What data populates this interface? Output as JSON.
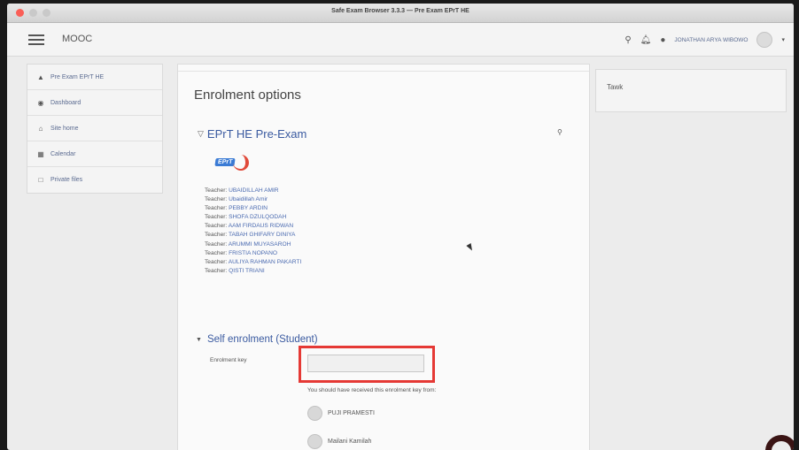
{
  "window": {
    "title": "Safe Exam Browser 3.3.3 — Pre Exam EPrT HE"
  },
  "navbar": {
    "brand": "MOOC",
    "user_name": "JONATHAN ARYA WIBOWO"
  },
  "sidebar": {
    "items": [
      {
        "label": "Pre Exam EPrT HE",
        "icon": "graduation-cap-icon"
      },
      {
        "label": "Dashboard",
        "icon": "dashboard-icon"
      },
      {
        "label": "Site home",
        "icon": "home-icon"
      },
      {
        "label": "Calendar",
        "icon": "calendar-icon"
      },
      {
        "label": "Private files",
        "icon": "file-icon"
      }
    ]
  },
  "main": {
    "page_title": "Enrolment options",
    "course_title": "EPrT HE Pre-Exam",
    "logo_text": "EPrT",
    "teacher_prefix": "Teacher: ",
    "teachers": [
      "UBAIDILLAH AMIR",
      "Ubaidillah Amir",
      "PEBBY ARDIN",
      "SHOFA DZULQODAH",
      "AAM FIRDAUS RIDWAN",
      "TABAH GHIFARY DINIYA",
      "ARUMMI MUYASAROH",
      "FRISTIA NOPANO",
      "AULIYA RAHMAN PAKARTI",
      "QISTI TRIANI"
    ],
    "self_enrolment_title": "Self enrolment (Student)",
    "enrolment_key_label": "Enrolment key",
    "enrolment_key_value": "",
    "received_note": "You should have received this enrolment key from:",
    "contacts": [
      "PUJI PRAMESTI",
      "Mailani Kamilah"
    ]
  },
  "block": {
    "title": "Tawk"
  },
  "colors": {
    "link": "#3a5aa0",
    "highlight": "#e53935",
    "close": "#fa5f57"
  }
}
